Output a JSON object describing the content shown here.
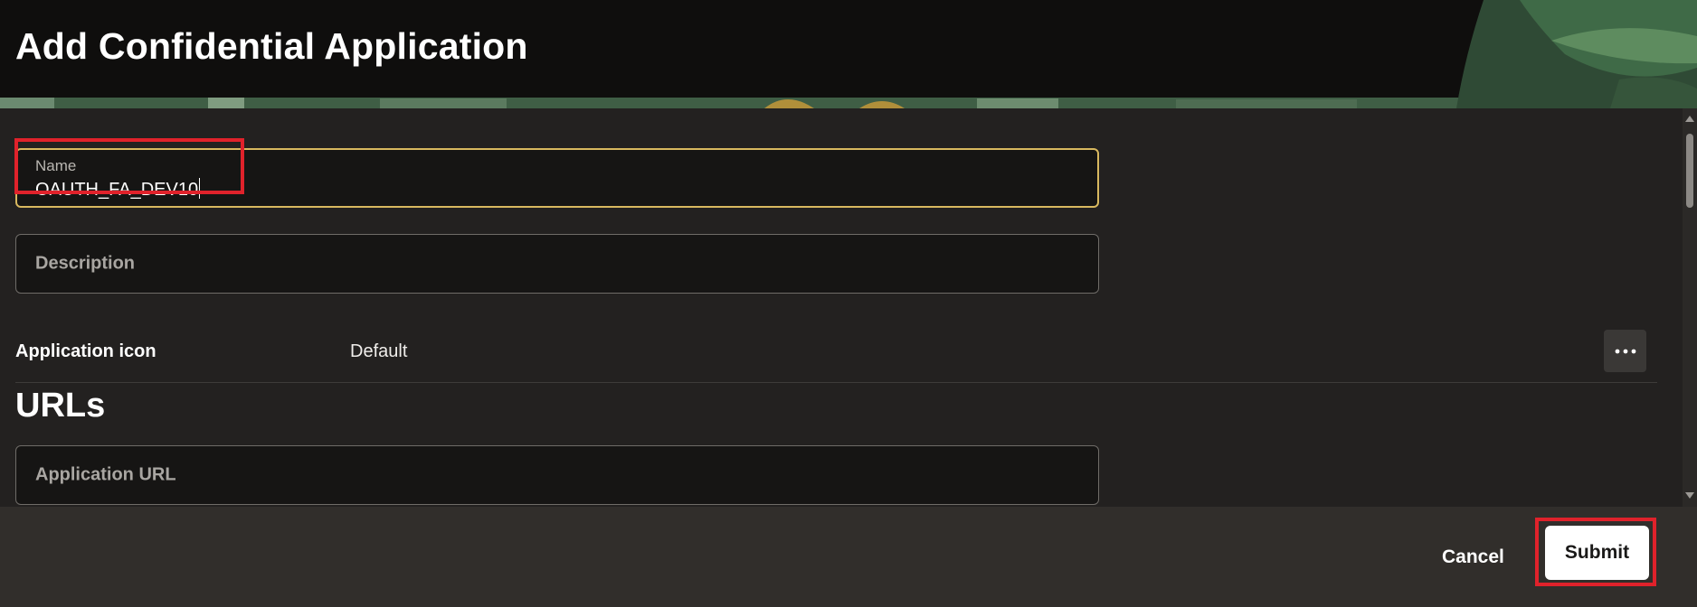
{
  "header": {
    "title": "Add Confidential Application"
  },
  "form": {
    "name_field": {
      "label": "Name",
      "value": "OAUTH_FA_DEV10"
    },
    "description_field": {
      "placeholder": "Description"
    },
    "application_icon": {
      "label": "Application icon",
      "value": "Default",
      "menu_icon": "more-horizontal-icon"
    },
    "urls_section": {
      "title": "URLs",
      "application_url_field": {
        "placeholder": "Application URL"
      }
    }
  },
  "footer": {
    "cancel_label": "Cancel",
    "submit_label": "Submit"
  },
  "colors": {
    "focus_border": "#d8b85f",
    "annotation_highlight": "#e0222b",
    "header_background": "#0f0e0d",
    "content_background": "#232120",
    "footer_background": "#312e2b"
  }
}
